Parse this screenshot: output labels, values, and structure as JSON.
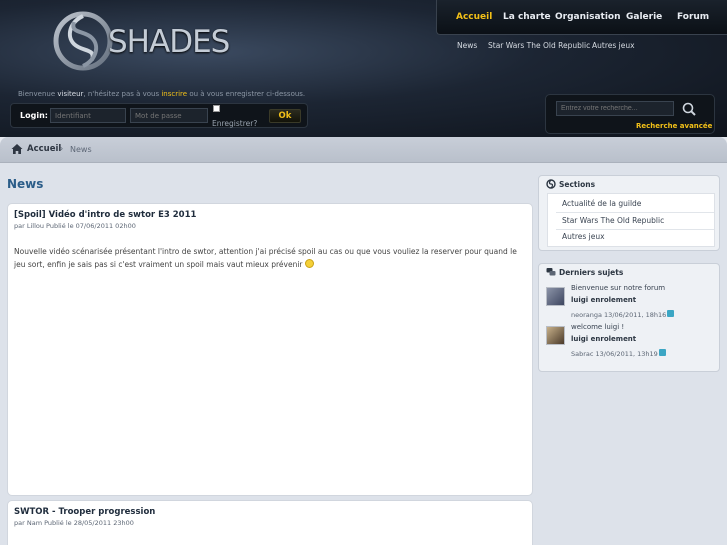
{
  "brand": {
    "name": "SHADES"
  },
  "topnav": [
    "Accueil",
    "La charte",
    "Organisation",
    "Galerie",
    "Forum"
  ],
  "subnav": [
    "News",
    "Star Wars The Old Republic",
    "Autres jeux"
  ],
  "welcome": {
    "prefix": "Bienvenue ",
    "visitor": "visiteur",
    "middle": ", n'hésitez pas à vous ",
    "register": "inscrire",
    "suffix": " ou à vous enregistrer ci-dessous."
  },
  "login": {
    "label": "Login:",
    "id_placeholder": "Identifiant",
    "pw_placeholder": "Mot de passe",
    "remember_label": "Enregistrer?",
    "ok_label": "Ok"
  },
  "search": {
    "placeholder": "Entrez votre recherche...",
    "advanced_label": "Recherche avancée"
  },
  "breadcrumb": {
    "home": "Accueil",
    "current": "News"
  },
  "page_title": "News",
  "articles": [
    {
      "title": "[Spoil] Vidéo d'intro de swtor E3 2011",
      "meta": "par Lillou Publié le 07/06/2011 02h00",
      "body": "Nouvelle vidéo scénarisée présentant l'intro de swtor, attention j'ai précisé spoil au cas ou que vous vouliez la reserver pour quand le jeu sort, enfin je sais pas si c'est vraiment un spoil mais vaut mieux prévenir"
    },
    {
      "title": "SWTOR - Trooper progression",
      "meta": "par Nam Publié le 28/05/2011 23h00"
    }
  ],
  "sections": {
    "title": "Sections",
    "items": [
      "Actualité de la guilde",
      "Star Wars The Old Republic",
      "Autres jeux"
    ]
  },
  "recent": {
    "title": "Derniers sujets",
    "topics": [
      {
        "title": "Bienvenue sur notre forum",
        "author": "luigi enrolement",
        "meta": "neoranga 13/06/2011, 18h16"
      },
      {
        "title": "welcome luigi !",
        "author": "luigi enrolement",
        "meta": "Sabrac 13/06/2011, 13h19"
      }
    ]
  },
  "colors": {
    "accent": "#f2c018",
    "title_blue": "#2b5d89",
    "header_dark": "#1c2533"
  }
}
